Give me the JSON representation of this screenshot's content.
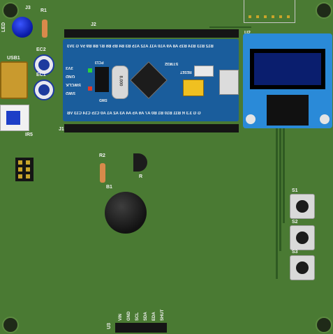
{
  "board": {
    "labels": {
      "j3": "J3",
      "led": "LED",
      "r1": "R1",
      "ec2": "EC2",
      "ec1": "EC1",
      "usb1": "USB1",
      "ir5": "IR5",
      "j2": "J2",
      "j1": "J1",
      "u2": "U2",
      "r2": "R2",
      "b1": "B1",
      "r": "R",
      "s1": "S1",
      "s2": "S2",
      "s3": "S3",
      "u3": "U3",
      "mcu_top": "STM32",
      "crystal": "8.000",
      "reset": "RESET",
      "swd_mark": "SWD",
      "pc13": "PC13"
    },
    "u3_pins": [
      "VIN",
      "GND",
      "SCL",
      "SDA",
      "EDA",
      "SHUT"
    ],
    "bluepill_side_labels": [
      "3V3",
      "GND",
      "SWCLK",
      "SWD"
    ],
    "top_header_text": "B12 B13 B14 B15 A8 A9 A10 A11 A12 A15 B3 B4 B5 B6 B7 B8 B9 5V G 3V3",
    "bottom_header_text": "G G 3.3 R B11 B10 B1 B0 A7 A6 A5 A4 A3 A2 A1 A0 C15 C14 C13 VB"
  }
}
